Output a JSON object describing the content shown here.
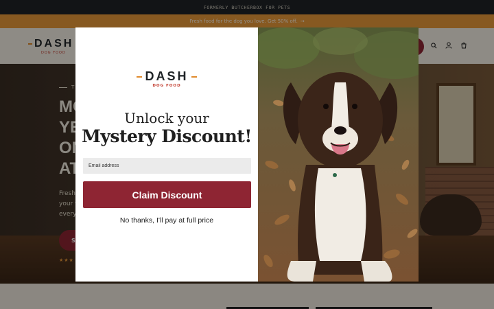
{
  "topbar": {
    "text": "FORMERLY BUTCHERBOX FOR PETS"
  },
  "promo": {
    "text": "Fresh food for the dog you love. Get 50% off.",
    "arrow": "→"
  },
  "header": {
    "logo_word": "DASH",
    "logo_sub": "DOG FOOD",
    "icons": [
      "search-icon",
      "account-icon",
      "cart-icon"
    ]
  },
  "hero": {
    "kicker": "T",
    "title": "MO\nYE\nON\nAT",
    "desc": "Fresh\nyour f\nevery",
    "button_label": "S",
    "rating_stars": "★★★"
  },
  "modal": {
    "logo_word": "DASH",
    "logo_sub": "DOG FOOD",
    "headline_line1": "Unlock your",
    "headline_line2": "Mystery Discount!",
    "email_placeholder": "Email address",
    "claim_label": "Claim Discount",
    "decline_label": "No thanks, I'll pay at full price",
    "image_subject": "dog-photo"
  },
  "colors": {
    "brand_red": "#8e2533",
    "brand_orange": "#e08a2c",
    "promo_bg": "#e89a3a",
    "topbar_bg": "#1f2427"
  }
}
